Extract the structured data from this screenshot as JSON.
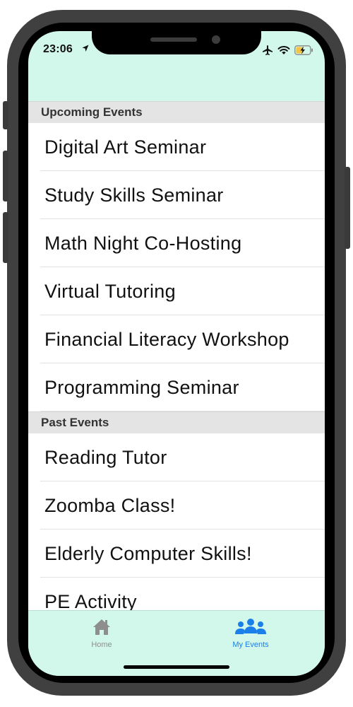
{
  "status_bar": {
    "time": "23:06",
    "icons": [
      "location-arrow-icon",
      "airplane-icon",
      "wifi-icon",
      "battery-charging-icon"
    ]
  },
  "sections": [
    {
      "title": "Upcoming Events",
      "items": [
        "Digital Art Seminar",
        "Study Skills Seminar",
        "Math Night Co-Hosting",
        "Virtual Tutoring",
        "Financial Literacy Workshop",
        "Programming Seminar"
      ]
    },
    {
      "title": "Past Events",
      "items": [
        "Reading Tutor",
        "Zoomba Class!",
        "Elderly Computer Skills!",
        "PE Activity"
      ]
    }
  ],
  "tabbar": {
    "tabs": [
      {
        "label": "Home",
        "icon": "home-icon",
        "selected": false
      },
      {
        "label": "My Events",
        "icon": "people-icon",
        "selected": true
      }
    ]
  },
  "colors": {
    "screen_bg": "#d2f8ec",
    "section_header_bg": "#e4e4e4",
    "accent": "#1a7fe8",
    "inactive_tab": "#8e8e8e"
  }
}
